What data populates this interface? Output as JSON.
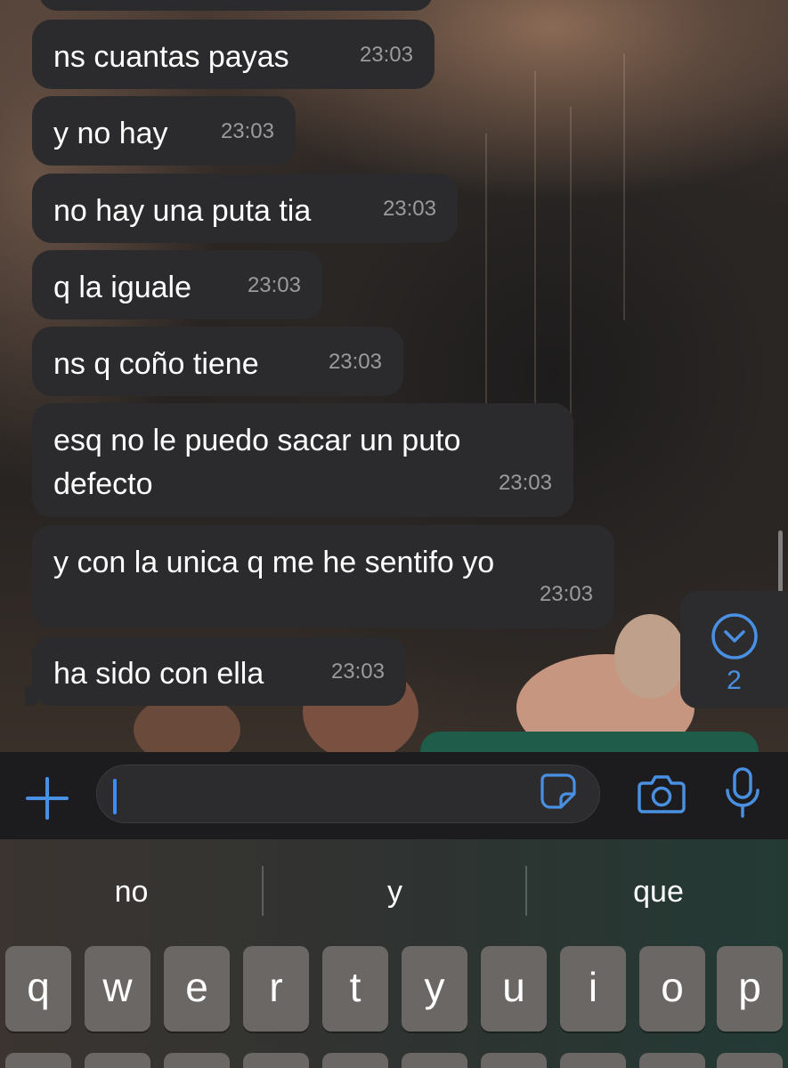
{
  "accent_color": "#4a90e2",
  "messages": [
    {
      "text": "ns cuantas payas",
      "time": "23:03"
    },
    {
      "text": "y no hay",
      "time": "23:03"
    },
    {
      "text": "no hay una puta tia",
      "time": "23:03"
    },
    {
      "text": "q la iguale",
      "time": "23:03"
    },
    {
      "text": "ns q coño tiene",
      "time": "23:03"
    },
    {
      "text": "esq no le puedo sacar un puto\ndefecto",
      "time": "23:03"
    },
    {
      "text": "y con la unica q me he sentifo yo",
      "time": "23:03"
    },
    {
      "text": "ha sido con ella",
      "time": "23:03"
    }
  ],
  "scroll_down_button": {
    "icon": "chevron-down-circle-icon",
    "unread_count": "2"
  },
  "composer": {
    "add_icon": "plus-icon",
    "sticker_icon": "sticker-icon",
    "camera_icon": "camera-icon",
    "mic_icon": "microphone-icon"
  },
  "keyboard": {
    "suggestions": [
      "no",
      "y",
      "que"
    ],
    "row1": [
      "q",
      "w",
      "e",
      "r",
      "t",
      "y",
      "u",
      "i",
      "o",
      "p"
    ]
  }
}
